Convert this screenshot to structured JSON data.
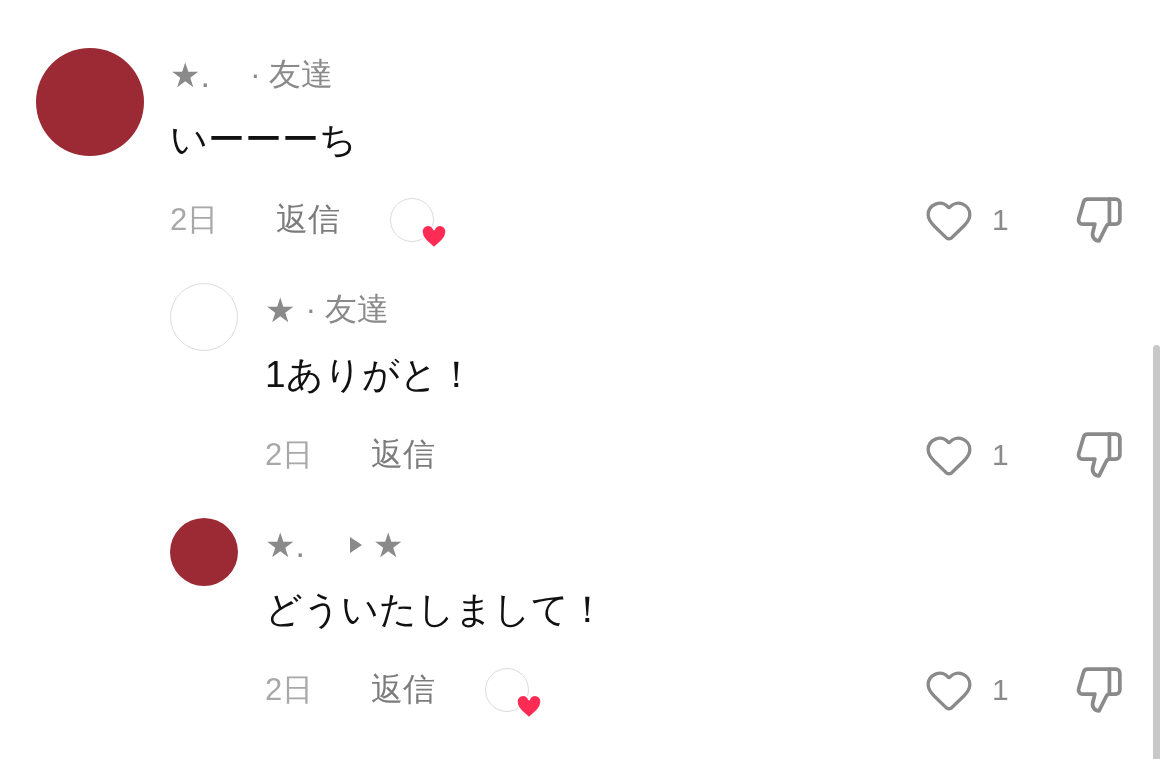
{
  "comments": [
    {
      "author": "★.",
      "kind": "photo",
      "label": "· 友達",
      "text": "いーーーち",
      "time": "2日",
      "reply_label": "返信",
      "liked_by_creator": true,
      "liked": false,
      "likes": "1",
      "replies": [
        {
          "author": "★",
          "kind": "illustration",
          "label": "· 友達",
          "text": "1ありがと！",
          "time": "2日",
          "reply_label": "返信",
          "liked_by_creator": false,
          "liked": false,
          "likes": "1"
        },
        {
          "author": "★.",
          "kind": "photo",
          "reply_to": "★",
          "text": "どういたしまして！",
          "time": "2日",
          "reply_label": "返信",
          "liked_by_creator": true,
          "liked": false,
          "likes": "1"
        }
      ]
    }
  ]
}
